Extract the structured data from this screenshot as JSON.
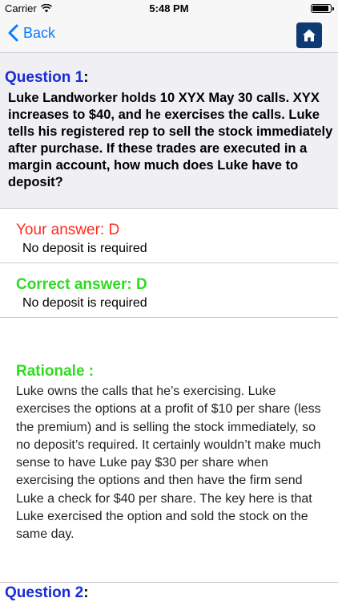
{
  "status_bar": {
    "carrier": "Carrier",
    "time": "5:48 PM"
  },
  "nav": {
    "back_label": "Back",
    "home_icon": "home-icon"
  },
  "question": {
    "label": "Question 1",
    "colon": ":",
    "text": "Luke Landworker holds 10 XYX May 30 calls. XYX increases to $40, and he exercises the calls. Luke tells his registered rep to sell the stock immediately after purchase. If these trades are executed in a margin account, how much does Luke have to deposit?"
  },
  "your_answer": {
    "title": "Your answer: D",
    "text": "No deposit is required"
  },
  "correct_answer": {
    "title": "Correct answer: D",
    "text": "No deposit is required"
  },
  "rationale": {
    "title": "Rationale :",
    "text": "Luke owns the calls that he’s exercising. Luke exercises the options at a profit of $10 per share (less the premium) and is selling the stock immediately, so no deposit’s required. It certainly wouldn’t make much sense to have Luke pay $30 per share when exercising the options and then have the firm send Luke a check for $40 per share. The key here is that Luke exercised the option and sold the stock on the same day."
  },
  "next_question": {
    "label": "Question 2",
    "colon": ":"
  },
  "colors": {
    "question_blue": "#1a2bd6",
    "wrong_red": "#ff2a1f",
    "correct_green": "#2edc1f",
    "ios_blue": "#0a7aff",
    "home_navy": "#0e3a73"
  }
}
